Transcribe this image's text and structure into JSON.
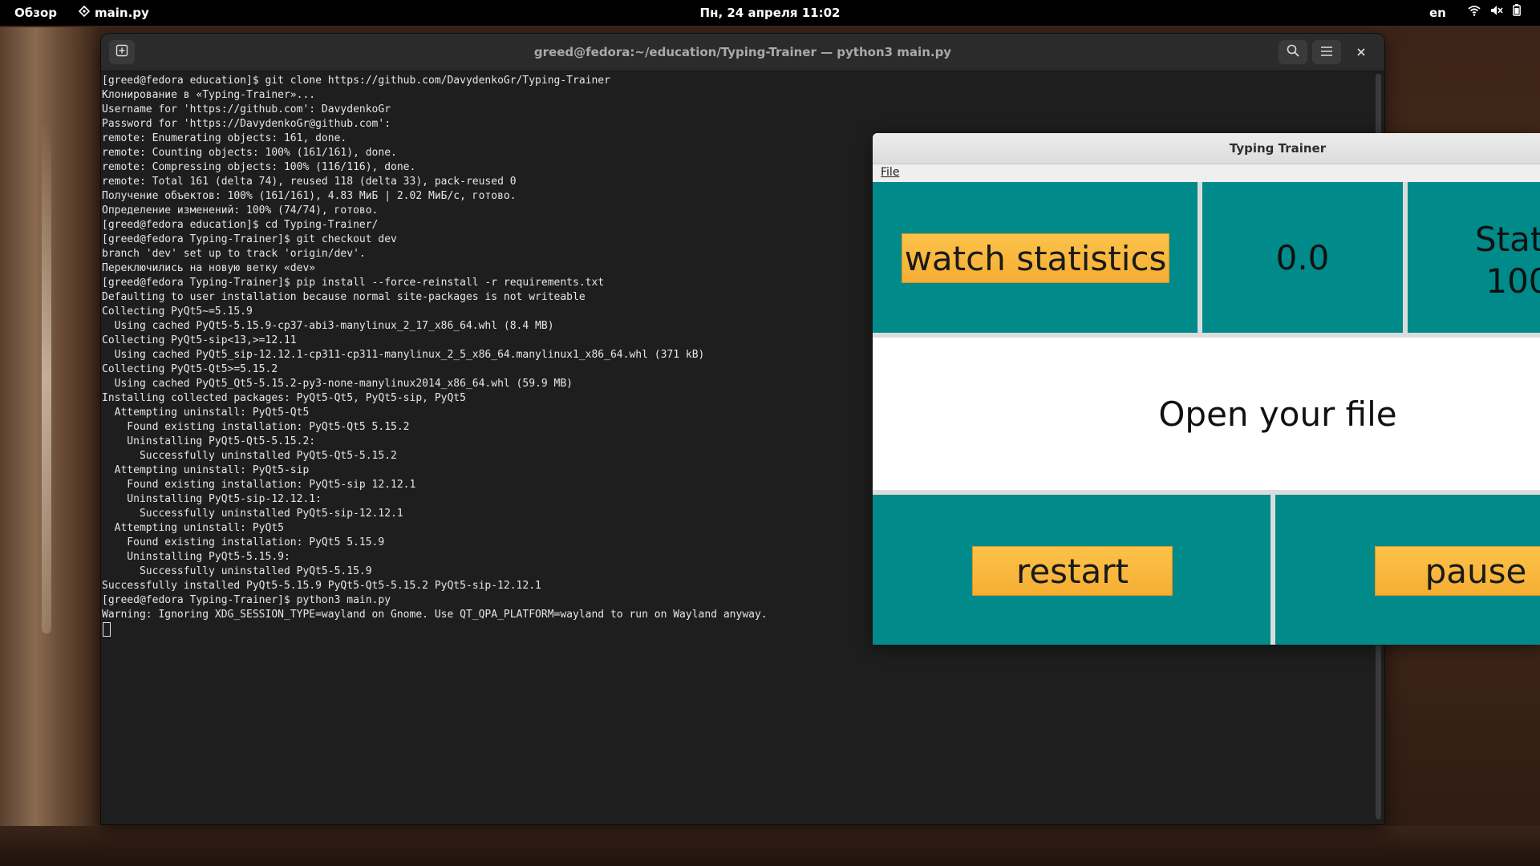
{
  "topbar": {
    "overview": "Обзор",
    "app_name": "main.py",
    "clock": "Пн, 24 апреля  11:02",
    "lang": "en"
  },
  "terminal": {
    "title": "greed@fedora:~/education/Typing-Trainer — python3 main.py",
    "lines": [
      "[greed@fedora education]$ git clone https://github.com/DavydenkoGr/Typing-Trainer",
      "Клонирование в «Typing-Trainer»...",
      "Username for 'https://github.com': DavydenkoGr",
      "Password for 'https://DavydenkoGr@github.com':",
      "remote: Enumerating objects: 161, done.",
      "remote: Counting objects: 100% (161/161), done.",
      "remote: Compressing objects: 100% (116/116), done.",
      "remote: Total 161 (delta 74), reused 118 (delta 33), pack-reused 0",
      "Получение объектов: 100% (161/161), 4.83 МиБ | 2.02 МиБ/с, готово.",
      "Определение изменений: 100% (74/74), готово.",
      "[greed@fedora education]$ cd Typing-Trainer/",
      "[greed@fedora Typing-Trainer]$ git checkout dev",
      "branch 'dev' set up to track 'origin/dev'.",
      "Переключились на новую ветку «dev»",
      "[greed@fedora Typing-Trainer]$ pip install --force-reinstall -r requirements.txt",
      "Defaulting to user installation because normal site-packages is not writeable",
      "Collecting PyQt5~=5.15.9",
      "  Using cached PyQt5-5.15.9-cp37-abi3-manylinux_2_17_x86_64.whl (8.4 MB)",
      "Collecting PyQt5-sip<13,>=12.11",
      "  Using cached PyQt5_sip-12.12.1-cp311-cp311-manylinux_2_5_x86_64.manylinux1_x86_64.whl (371 kB)",
      "Collecting PyQt5-Qt5>=5.15.2",
      "  Using cached PyQt5_Qt5-5.15.2-py3-none-manylinux2014_x86_64.whl (59.9 MB)",
      "Installing collected packages: PyQt5-Qt5, PyQt5-sip, PyQt5",
      "  Attempting uninstall: PyQt5-Qt5",
      "    Found existing installation: PyQt5-Qt5 5.15.2",
      "    Uninstalling PyQt5-Qt5-5.15.2:",
      "      Successfully uninstalled PyQt5-Qt5-5.15.2",
      "  Attempting uninstall: PyQt5-sip",
      "    Found existing installation: PyQt5-sip 12.12.1",
      "    Uninstalling PyQt5-sip-12.12.1:",
      "      Successfully uninstalled PyQt5-sip-12.12.1",
      "  Attempting uninstall: PyQt5",
      "    Found existing installation: PyQt5 5.15.9",
      "    Uninstalling PyQt5-5.15.9:",
      "      Successfully uninstalled PyQt5-5.15.9",
      "Successfully installed PyQt5-5.15.9 PyQt5-Qt5-5.15.2 PyQt5-sip-12.12.1",
      "[greed@fedora Typing-Trainer]$ python3 main.py",
      "Warning: Ignoring XDG_SESSION_TYPE=wayland on Gnome. Use QT_QPA_PLATFORM=wayland to run on Wayland anyway."
    ]
  },
  "trainer": {
    "title": "Typing Trainer",
    "menu_file": "File",
    "watch_statistics_label": "watch statistics",
    "speed_value": "0.0",
    "stat_text": "Stat\n 100",
    "text_area": "Open your file",
    "restart_label": "restart",
    "pause_label": "pause"
  },
  "colors": {
    "panel_teal": "#008a8a",
    "button_orange": "#f5ae33",
    "terminal_bg": "#1e1e1e"
  }
}
